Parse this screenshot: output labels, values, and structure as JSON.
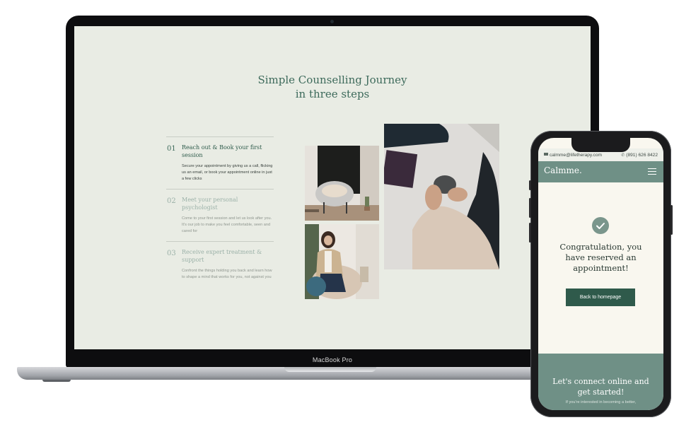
{
  "laptop": {
    "model_label": "MacBook Pro",
    "journey": {
      "title_line1": "Simple Counselling Journey",
      "title_line2": "in three steps",
      "steps": [
        {
          "number": "01",
          "title": "Reach out & Book your first session",
          "description": "Secure your appointment by giving us a call, flicking us an email, or book your appointment online in just a few clicks"
        },
        {
          "number": "02",
          "title": "Meet your personal psychologist",
          "description": "Come to your first session and let us look after you. It's our job to make you feel comfortable, seen and cared for"
        },
        {
          "number": "03",
          "title": "Receive expert treatment & support",
          "description": "Confront the things holding you back and learn how to shape a mind that works for you, not against you"
        }
      ]
    }
  },
  "phone": {
    "topbar": {
      "email": "calmme@lifetherapy.com",
      "phone": "(891) 626 8422"
    },
    "brand": "Calmme.",
    "confirmation": {
      "message": "Congratulation, you have reserved an appointment!",
      "button_label": "Back to homepage"
    },
    "footer": {
      "title": "Let's connect online and get started!",
      "subtitle": "If you're interested in becoming a better,"
    }
  },
  "colors": {
    "accent_green": "#2f5a4b",
    "sage": "#6f9086",
    "screen_bg": "#e9ece4"
  }
}
